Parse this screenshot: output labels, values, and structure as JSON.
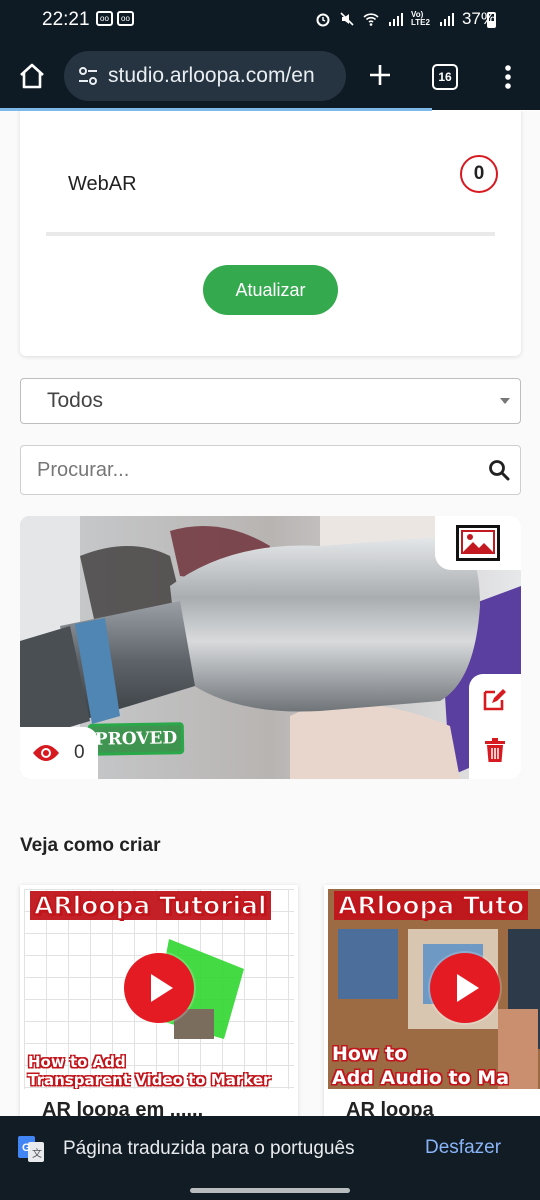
{
  "status_bar": {
    "time": "22:21",
    "battery": "37%"
  },
  "browser": {
    "url": "studio.arloopa.com/en",
    "tab_count": "16"
  },
  "platform_card": {
    "label": "WebAR",
    "count": "0",
    "update_button": "Atualizar"
  },
  "filter": {
    "selected": "Todos"
  },
  "search": {
    "placeholder": "Procurar..."
  },
  "project": {
    "views": "0",
    "status_stamp": "PROVED"
  },
  "tutorials": {
    "section_title": "Veja como criar",
    "items": [
      {
        "thumb_title": "ARloopa Tutorial",
        "thumb_line1": "How to Add",
        "thumb_line2": "Transparent Video to Marker",
        "caption": "AR loopa em ......"
      },
      {
        "thumb_title": "ARloopa Tuto",
        "thumb_line1": "How to",
        "thumb_line2": "Add Audio to Ma",
        "caption": "AR loopa"
      }
    ]
  },
  "translate_bar": {
    "message": "Página traduzida para o português",
    "undo": "Desfazer"
  },
  "colors": {
    "accent_green": "#35a94e",
    "danger_red": "#d71920",
    "link_blue": "#8ab4f8",
    "chrome_dark": "#0f1b24"
  }
}
